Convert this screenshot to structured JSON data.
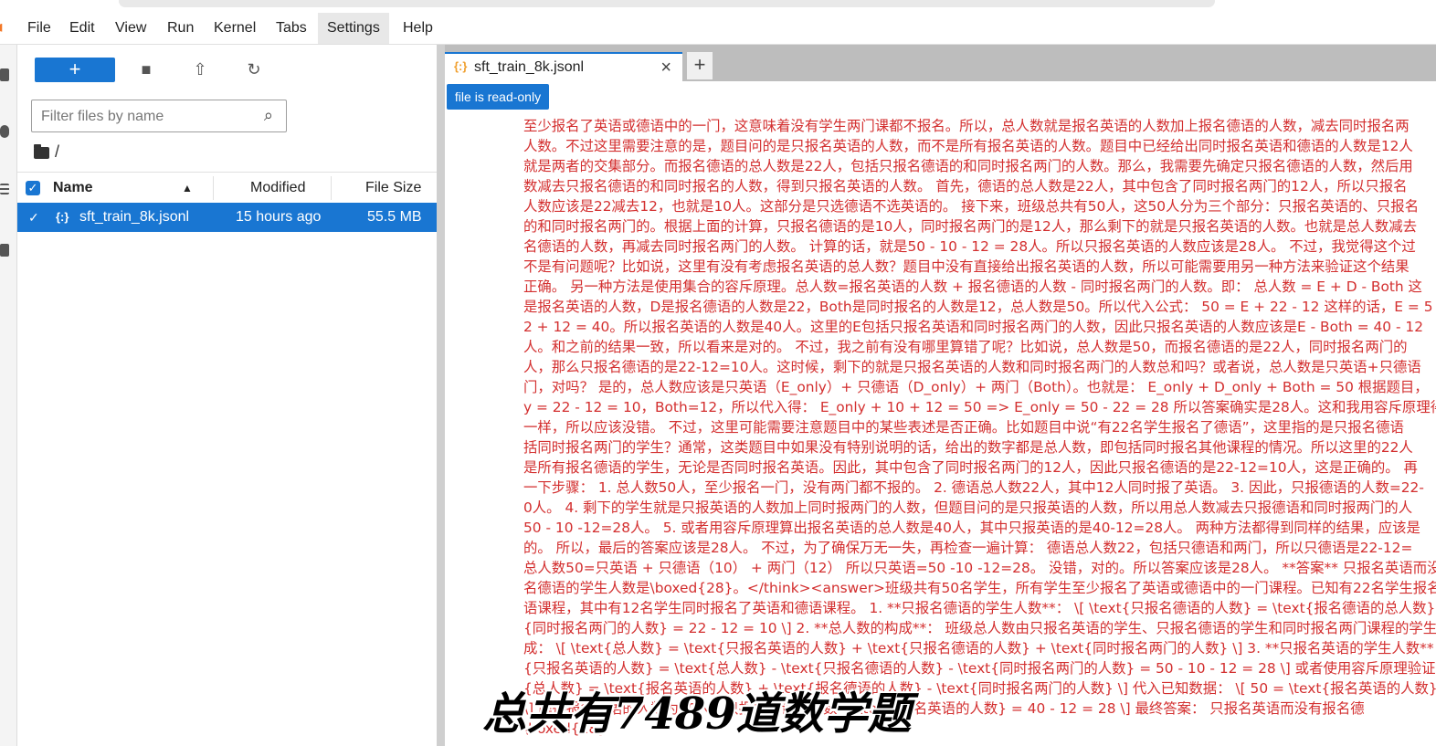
{
  "menubar": {
    "items": [
      "File",
      "Edit",
      "View",
      "Run",
      "Kernel",
      "Tabs",
      "Settings",
      "Help"
    ],
    "active": "Settings"
  },
  "filebrowser": {
    "new_label": "+",
    "filter_placeholder": "Filter files by name",
    "breadcrumb": "/",
    "columns": {
      "name": "Name",
      "modified": "Modified",
      "size": "File Size"
    },
    "files": [
      {
        "name": "sft_train_8k.jsonl",
        "modified": "15 hours ago",
        "size": "55.5 MB",
        "selected": true
      }
    ]
  },
  "tab": {
    "icon": "{:}",
    "title": "sft_train_8k.jsonl",
    "close": "×",
    "add": "+"
  },
  "editor": {
    "readonly_label": "file is read-only",
    "lines": [
      "至少报名了英语或德语中的一门，这意味着没有学生两门课都不报名。所以，总人数就是报名英语的人数加上报名德语的人数，减去同时报名两",
      "人数。不过这里需要注意的是，题目问的是只报名英语的人数，而不是所有报名英语的人数。题目中已经给出同时报名英语和德语的人数是12人",
      "就是两者的交集部分。而报名德语的总人数是22人，包括只报名德语的和同时报名两门的人数。那么，我需要先确定只报名德语的人数，然后用",
      "数减去只报名德语的和同时报名的人数，得到只报名英语的人数。 首先，德语的总人数是22人，其中包含了同时报名两门的12人，所以只报名",
      "人数应该是22减去12，也就是10人。这部分是只选德语不选英语的。 接下来，班级总共有50人，这50人分为三个部分：只报名英语的、只报名",
      "的和同时报名两门的。根据上面的计算，只报名德语的是10人，同时报名两门的是12人，那么剩下的就是只报名英语的人数。也就是总人数减去",
      "名德语的人数，再减去同时报名两门的人数。 计算的话，就是50 - 10 - 12 = 28人。所以只报名英语的人数应该是28人。 不过，我觉得这个过",
      "不是有问题呢？比如说，这里有没有考虑报名英语的总人数？题目中没有直接给出报名英语的人数，所以可能需要用另一种方法来验证这个结果",
      "正确。 另一种方法是使用集合的容斥原理。总人数=报名英语的人数 + 报名德语的人数 - 同时报名两门的人数。即： 总人数 = E + D - Both 这",
      "是报名英语的人数，D是报名德语的人数是22，Both是同时报名的人数是12，总人数是50。所以代入公式： 50 = E + 22 - 12 这样的话，E = 5",
      "2 + 12 = 40。所以报名英语的人数是40人。这里的E包括只报名英语和同时报名两门的人数，因此只报名英语的人数应该是E - Both = 40 - 12",
      "人。和之前的结果一致，所以看来是对的。 不过，我之前有没有哪里算错了呢？比如说，总人数是50，而报名德语的是22人，同时报名两门的",
      "人，那么只报名德语的是22-12=10人。这时候，剩下的就是只报名英语的人数和同时报名两门的人数总和吗？或者说，总人数是只英语+只德语",
      "门，对吗？ 是的，总人数应该是只英语（E_only）+ 只德语（D_only）+ 两门（Both）。也就是： E_only + D_only + Both = 50 根据题目，",
      "y = 22 - 12 = 10，Both=12，所以代入得： E_only + 10 + 12 = 50 => E_only = 50 - 22 = 28 所以答案确实是28人。这和我用容斥原理得到的",
      "一样，所以应该没错。 不过，这里可能需要注意题目中的某些表述是否正确。比如题目中说“有22名学生报名了德语”，这里指的是只报名德语",
      "括同时报名两门的学生？通常，这类题目中如果没有特别说明的话，给出的数字都是总人数，即包括同时报名其他课程的情况。所以这里的22人",
      "是所有报名德语的学生，无论是否同时报名英语。因此，其中包含了同时报名两门的12人，因此只报名德语的是22-12=10人，这是正确的。 再",
      "一下步骤： 1. 总人数50人，至少报名一门，没有两门都不报的。 2. 德语总人数22人，其中12人同时报了英语。 3. 因此，只报德语的人数=22-",
      "0人。 4. 剩下的学生就是只报英语的人数加上同时报两门的人数，但题目问的是只报英语的人数，所以用总人数减去只报德语和同时报两门的人",
      "50 - 10 -12=28人。 5. 或者用容斥原理算出报名英语的总人数是40人，其中只报英语的是40-12=28人。 两种方法都得到同样的结果，应该是",
      "的。 所以，最后的答案应该是28人。 不过，为了确保万无一失，再检查一遍计算： 德语总人数22，包括只德语和两门，所以只德语是22-12=",
      "总人数50=只英语 + 只德语（10） + 两门（12） 所以只英语=50 -10 -12=28。 没错，对的。所以答案应该是28人。 **答案** 只报名英语而没",
      "名德语的学生人数是\\boxed{28}。</think><answer>班级共有50名学生，所有学生至少报名了英语或德语中的一门课程。已知有22名学生报名",
      "语课程，其中有12名学生同时报名了英语和德语课程。 1. **只报名德语的学生人数**： \\[ \\text{只报名德语的人数} = \\text{报名德语的总人数}",
      "{同时报名两门的人数} = 22 - 12 = 10 \\] 2. **总人数的构成**： 班级总人数由只报名英语的学生、只报名德语的学生和同时报名两门课程的学生",
      "成： \\[ \\text{总人数} = \\text{只报名英语的人数} + \\text{只报名德语的人数} + \\text{同时报名两门的人数} \\] 3. **只报名英语的学生人数**： \\[",
      "{只报名英语的人数} = \\text{总人数} - \\text{只报名德语的人数} - \\text{同时报名两门的人数} = 50 - 10 - 12 = 28 \\] 或者使用容斥原理验证： \\[",
      "{总人数} = \\text{报名英语的人数} + \\text{报名德语的人数} - \\text{同时报名两门的人数} \\] 代入已知数据： \\[ 50 = \\text{报名英语的人数} + 22",
      "\\] 解得报名英语的人数为40人，只报名英语的人数 = \\text{报名英语的人数} = 40 - 12 = 28 \\] 最终答案： 只报名英语而没有报名德",
      "\\boxed{28}"
    ]
  },
  "caption": "总共有7489道数学题",
  "colors": {
    "accent": "#1976d2",
    "code_text": "#d32f2f",
    "tab_bar": "#bdbdbd"
  }
}
